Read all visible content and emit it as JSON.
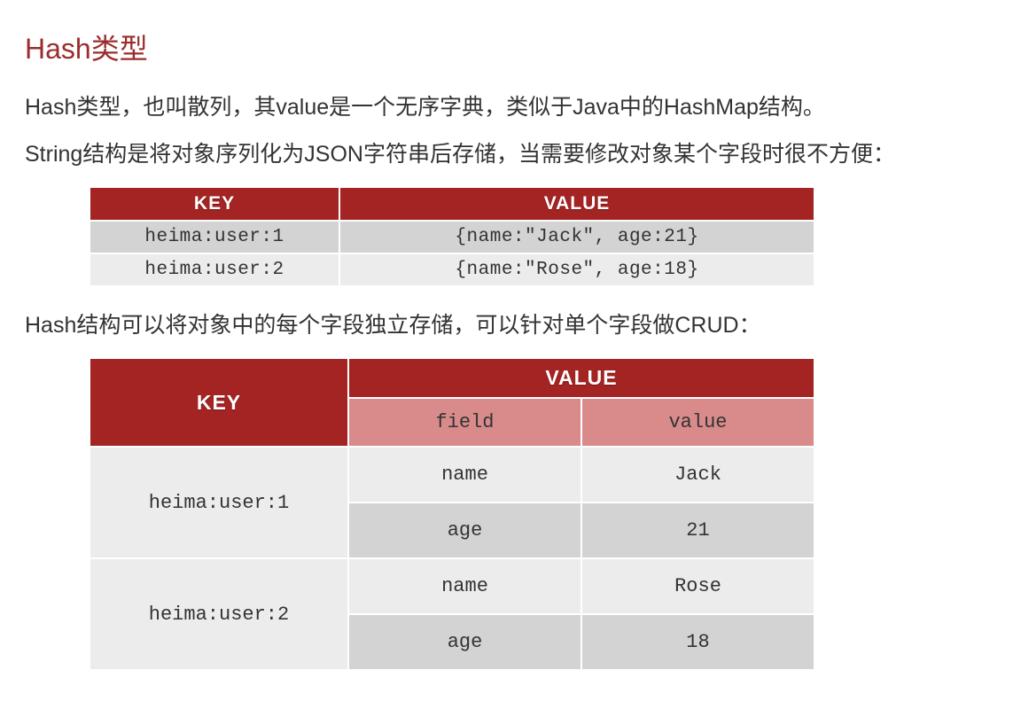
{
  "title": "Hash类型",
  "para1": "Hash类型，也叫散列，其value是一个无序字典，类似于Java中的HashMap结构。",
  "para2": "String结构是将对象序列化为JSON字符串后存储，当需要修改对象某个字段时很不方便：",
  "table1": {
    "headers": {
      "key": "KEY",
      "value": "VALUE"
    },
    "rows": [
      {
        "key": "heima:user:1",
        "value": "{name:\"Jack\", age:21}"
      },
      {
        "key": "heima:user:2",
        "value": "{name:\"Rose\", age:18}"
      }
    ]
  },
  "para3": "Hash结构可以将对象中的每个字段独立存储，可以针对单个字段做CRUD：",
  "table2": {
    "headers": {
      "key": "KEY",
      "value": "VALUE",
      "field": "field",
      "val": "value"
    },
    "rows": [
      {
        "key": "heima:user:1",
        "fields": [
          {
            "field": "name",
            "value": "Jack"
          },
          {
            "field": "age",
            "value": "21"
          }
        ]
      },
      {
        "key": "heima:user:2",
        "fields": [
          {
            "field": "name",
            "value": "Rose"
          },
          {
            "field": "age",
            "value": "18"
          }
        ]
      }
    ]
  }
}
